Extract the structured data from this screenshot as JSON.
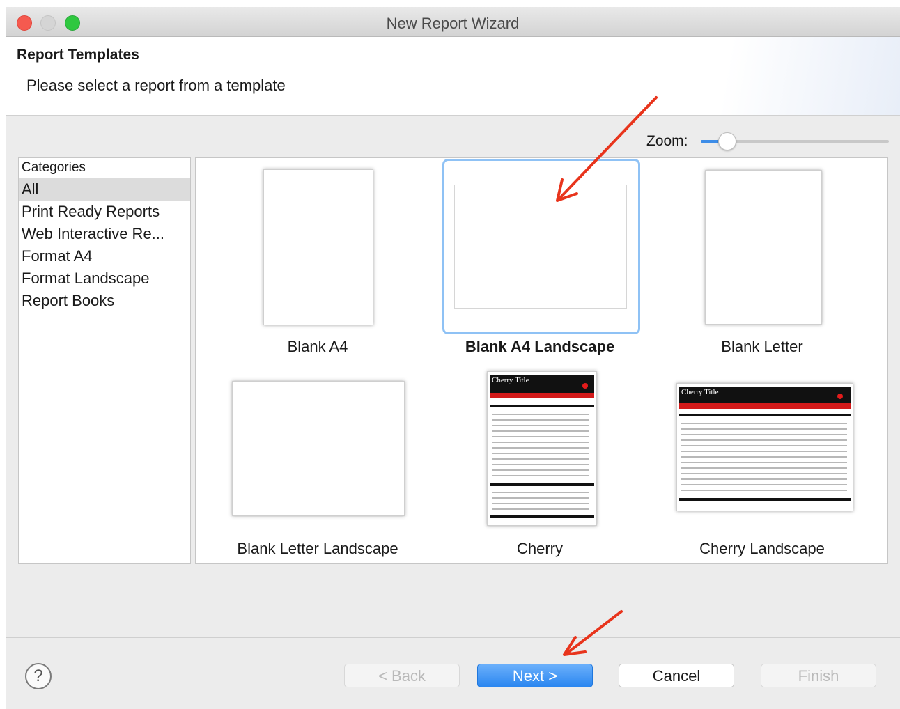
{
  "window": {
    "title": "New Report Wizard"
  },
  "header": {
    "title": "Report Templates",
    "subtitle": "Please select a report from a template"
  },
  "zoom": {
    "label": "Zoom:",
    "level": 0.1
  },
  "categories": {
    "header": "Categories",
    "items": [
      "All",
      "Print Ready Reports",
      "Web Interactive Re...",
      "Format A4",
      "Format Landscape",
      "Report Books"
    ],
    "selected": "All"
  },
  "templates": [
    {
      "label": "Blank A4"
    },
    {
      "label": "Blank A4 Landscape",
      "selected": true
    },
    {
      "label": "Blank Letter"
    },
    {
      "label": "Blank Letter Landscape"
    },
    {
      "label": "Cherry",
      "preview_title": "Cherry Title"
    },
    {
      "label": "Cherry Landscape",
      "preview_title": "Cherry Title"
    }
  ],
  "buttons": {
    "help": "?",
    "back": "< Back",
    "next": "Next >",
    "cancel": "Cancel",
    "finish": "Finish"
  },
  "colors": {
    "accent": "#2a86f0",
    "annotation_arrow": "#e8341c",
    "selection_border": "#8fc2f5"
  }
}
